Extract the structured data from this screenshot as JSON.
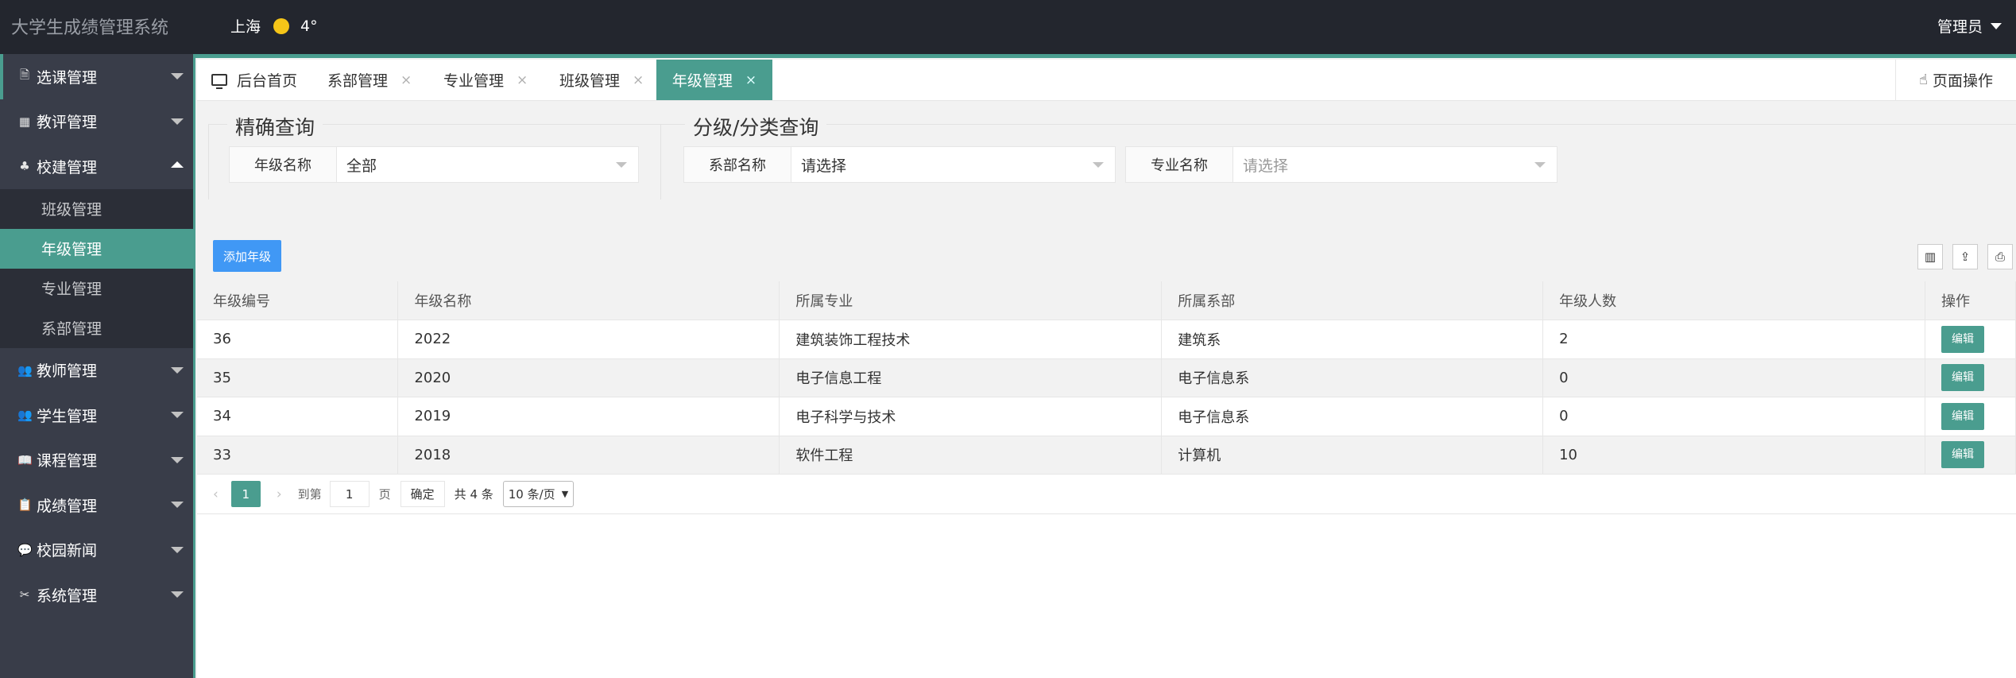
{
  "header": {
    "app_title": "大学生成绩管理系统",
    "city": "上海",
    "temperature": "4°",
    "user": "管理员"
  },
  "sidebar": {
    "items": [
      {
        "label": "选课管理",
        "icon": "document-icon"
      },
      {
        "label": "教评管理",
        "icon": "grid-icon"
      },
      {
        "label": "校建管理",
        "icon": "tree-icon",
        "expanded": true
      },
      {
        "label": "教师管理",
        "icon": "users-icon"
      },
      {
        "label": "学生管理",
        "icon": "users-icon"
      },
      {
        "label": "课程管理",
        "icon": "book-icon"
      },
      {
        "label": "成绩管理",
        "icon": "clipboard-icon"
      },
      {
        "label": "校园新闻",
        "icon": "chat-icon"
      },
      {
        "label": "系统管理",
        "icon": "tools-icon"
      }
    ],
    "sub_items": [
      {
        "label": "班级管理"
      },
      {
        "label": "年级管理",
        "active": true
      },
      {
        "label": "专业管理"
      },
      {
        "label": "系部管理"
      }
    ]
  },
  "tabs": {
    "items": [
      {
        "label": "后台首页"
      },
      {
        "label": "系部管理"
      },
      {
        "label": "专业管理"
      },
      {
        "label": "班级管理"
      },
      {
        "label": "年级管理",
        "active": true
      }
    ],
    "close_glyph": "×",
    "page_op": "页面操作"
  },
  "query": {
    "exact_title": "精确查询",
    "grade_label": "年级名称",
    "grade_value": "全部",
    "category_title": "分级/分类查询",
    "dept_label": "系部名称",
    "dept_value": "请选择",
    "major_label": "专业名称",
    "major_placeholder": "请选择"
  },
  "toolbar": {
    "add_label": "添加年级",
    "tools": [
      "columns-icon",
      "export-icon",
      "print-icon"
    ]
  },
  "table": {
    "headers": [
      "年级编号",
      "年级名称",
      "所属专业",
      "所属系部",
      "年级人数",
      "操作"
    ],
    "rows": [
      {
        "id": "36",
        "name": "2022",
        "major": "建筑装饰工程技术",
        "dept": "建筑系",
        "count": "2",
        "action": "编辑"
      },
      {
        "id": "35",
        "name": "2020",
        "major": "电子信息工程",
        "dept": "电子信息系",
        "count": "0",
        "action": "编辑"
      },
      {
        "id": "34",
        "name": "2019",
        "major": "电子科学与技术",
        "dept": "电子信息系",
        "count": "0",
        "action": "编辑"
      },
      {
        "id": "33",
        "name": "2018",
        "major": "软件工程",
        "dept": "计算机",
        "count": "10",
        "action": "编辑"
      }
    ]
  },
  "pager": {
    "current": "1",
    "goto_label": "到第",
    "goto_value": "1",
    "page_unit": "页",
    "confirm": "确定",
    "total": "共 4 条",
    "page_size": "10 条/页"
  },
  "colors": {
    "accent": "#4a9d8f",
    "header_bg": "#23262e",
    "sidebar_bg": "#393d49",
    "primary_button": "#4098f5"
  }
}
